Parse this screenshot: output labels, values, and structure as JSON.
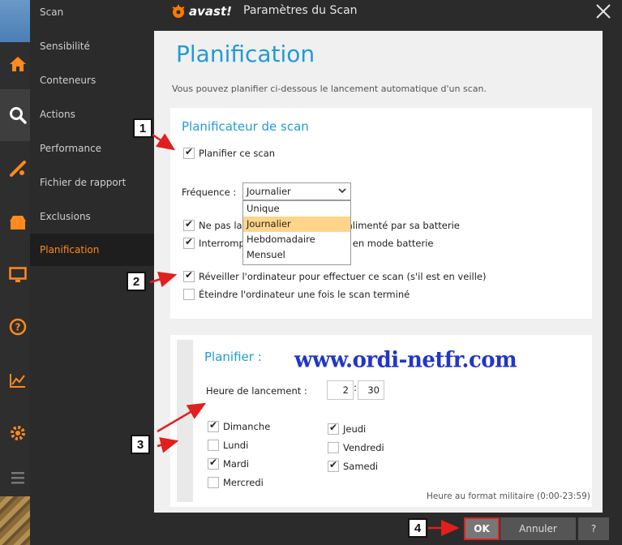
{
  "window": {
    "brand": "avast!",
    "title": "Paramètres du Scan"
  },
  "nav": {
    "items": [
      "Scan",
      "Sensibilité",
      "Conteneurs",
      "Actions",
      "Performance",
      "Fichier de rapport",
      "Exclusions",
      "Planification"
    ],
    "active": "Planification"
  },
  "page": {
    "title": "Planification",
    "description": "Vous pouvez planifier ci-dessous le lancement automatique d'un scan."
  },
  "scheduler": {
    "title": "Planificateur de scan",
    "schedule_checkbox": {
      "label": "Planifier ce scan",
      "checked": true
    },
    "frequency_label": "Fréquence :",
    "frequency_value": "Journalier",
    "frequency_options": [
      "Unique",
      "Journalier",
      "Hebdomadaire",
      "Mensuel"
    ],
    "battery_row_1": {
      "label_before": "Ne pas lan",
      "label_after": "ur est alimenté par sa batterie",
      "checked": true
    },
    "battery_row_2": {
      "label_before": "Interromp",
      "label_after": "r rentre en mode batterie",
      "checked": true
    },
    "wake_checkbox": {
      "label": "Réveiller l'ordinateur pour effectuer ce scan (s'il est en veille)",
      "checked": true
    },
    "shutdown_checkbox": {
      "label": "Éteindre l'ordinateur une fois le scan terminé",
      "checked": false
    }
  },
  "plan": {
    "title": "Planifier :",
    "launch_label": "Heure de lancement :",
    "hour": "2",
    "separator": ":",
    "minute": "30",
    "days_left": [
      {
        "label": "Dimanche",
        "checked": true
      },
      {
        "label": "Lundi",
        "checked": false
      },
      {
        "label": "Mardi",
        "checked": true
      },
      {
        "label": "Mercredi",
        "checked": false
      }
    ],
    "days_right": [
      {
        "label": "Jeudi",
        "checked": true
      },
      {
        "label": "Vendredi",
        "checked": false
      },
      {
        "label": "Samedi",
        "checked": true
      }
    ],
    "hint": "Heure au format militaire (0:00-23:59)"
  },
  "watermark": "www.ordi-netfr.com",
  "buttons": {
    "ok": "OK",
    "cancel": "Annuler",
    "help": "?"
  },
  "callouts": [
    "1",
    "2",
    "3",
    "4"
  ],
  "colors": {
    "accent_blue": "#1f9cd6",
    "nav_active": "#ff8a1d",
    "dark_bg": "#2b2b2b",
    "callout_arrow": "#e0201e"
  },
  "icons": {
    "app_strip": [
      "home-icon",
      "search-icon",
      "tools-icon",
      "store-icon",
      "monitor-icon",
      "help-icon",
      "stats-icon",
      "settings-icon",
      "menu-icon"
    ],
    "close": "close-icon"
  }
}
